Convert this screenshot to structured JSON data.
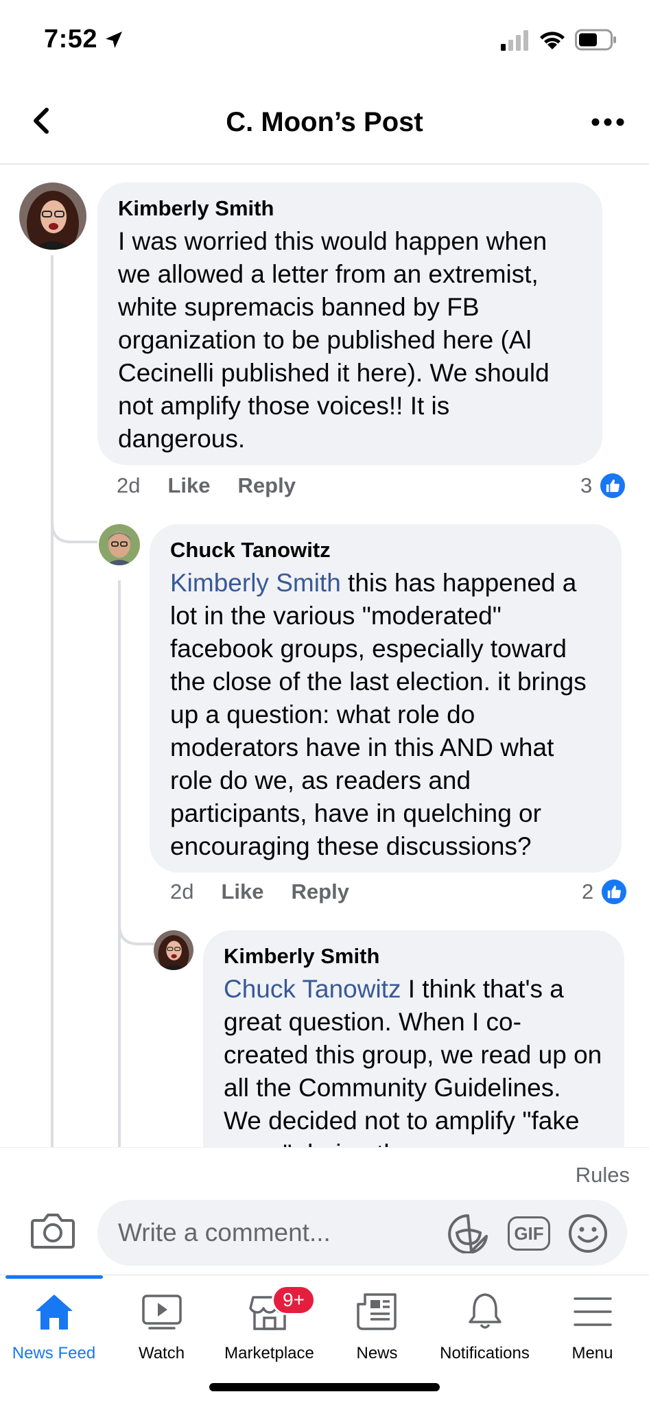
{
  "status_bar": {
    "time": "7:52"
  },
  "header": {
    "title": "C. Moon’s Post"
  },
  "comments": [
    {
      "author": "Kimberly Smith",
      "mention": "",
      "text": "I was worried this would happen when we allowed a letter from an extremist, white supremacis banned by FB organization to be published here (Al Cecinelli published it here).  We should not amplify those voices!! It is dangerous.",
      "time": "2d",
      "like_label": "Like",
      "reply_label": "Reply",
      "reactions": "3"
    },
    {
      "author": "Chuck Tanowitz",
      "mention": "Kimberly Smith",
      "text": " this has happened a lot in the various \"moderated\" facebook groups, especially toward the close of the last election. it brings up a question: what role do moderators have in this AND what role do we, as readers and participants, have in quelching or encouraging these discussions?",
      "time": "2d",
      "like_label": "Like",
      "reply_label": "Reply",
      "reactions": "2"
    },
    {
      "author": "Kimberly Smith",
      "mention": "Chuck Tanowitz",
      "text": " I think that's a great question. When I co-created this group, we read up on all the Community Guidelines. We decided not to amplify \"fake news\" during the"
    }
  ],
  "composer": {
    "rules_label": "Rules",
    "placeholder": "Write a comment...",
    "gif_label": "GIF"
  },
  "tabs": [
    {
      "label": "News Feed",
      "icon": "home-icon"
    },
    {
      "label": "Watch",
      "icon": "watch-icon"
    },
    {
      "label": "Marketplace",
      "icon": "marketplace-icon"
    },
    {
      "label": "News",
      "icon": "news-icon"
    },
    {
      "label": "Notifications",
      "icon": "bell-icon"
    },
    {
      "label": "Menu",
      "icon": "menu-icon"
    }
  ],
  "marketplace_badge": "9+",
  "colors": {
    "accent": "#1877f2",
    "mention": "#385898",
    "badge": "#e41e3f",
    "bubble": "#f0f2f5"
  }
}
